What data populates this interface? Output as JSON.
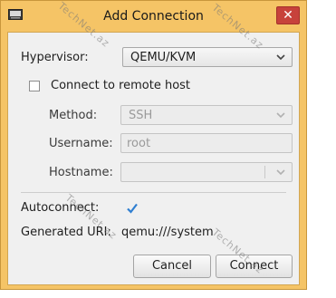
{
  "window": {
    "title": "Add Connection",
    "close_glyph": "✕",
    "app_icon": "virt-manager-icon"
  },
  "form": {
    "hypervisor_label": "Hypervisor:",
    "hypervisor_value": "QEMU/KVM",
    "remote_label": "Connect to remote host",
    "remote_checked": false,
    "method_label": "Method:",
    "method_value": "SSH",
    "username_label": "Username:",
    "username_value": "root",
    "hostname_label": "Hostname:",
    "hostname_value": "",
    "autoconnect_label": "Autoconnect:",
    "autoconnect_checked": true,
    "uri_label": "Generated URI:",
    "uri_value": "qemu:///system"
  },
  "buttons": {
    "cancel": "Cancel",
    "connect": "Connect"
  },
  "watermark": {
    "text": "TechNet.az"
  },
  "colors": {
    "title_bar": "#f5c466",
    "close_button": "#c7423b",
    "check_blue": "#2f7fd1"
  }
}
